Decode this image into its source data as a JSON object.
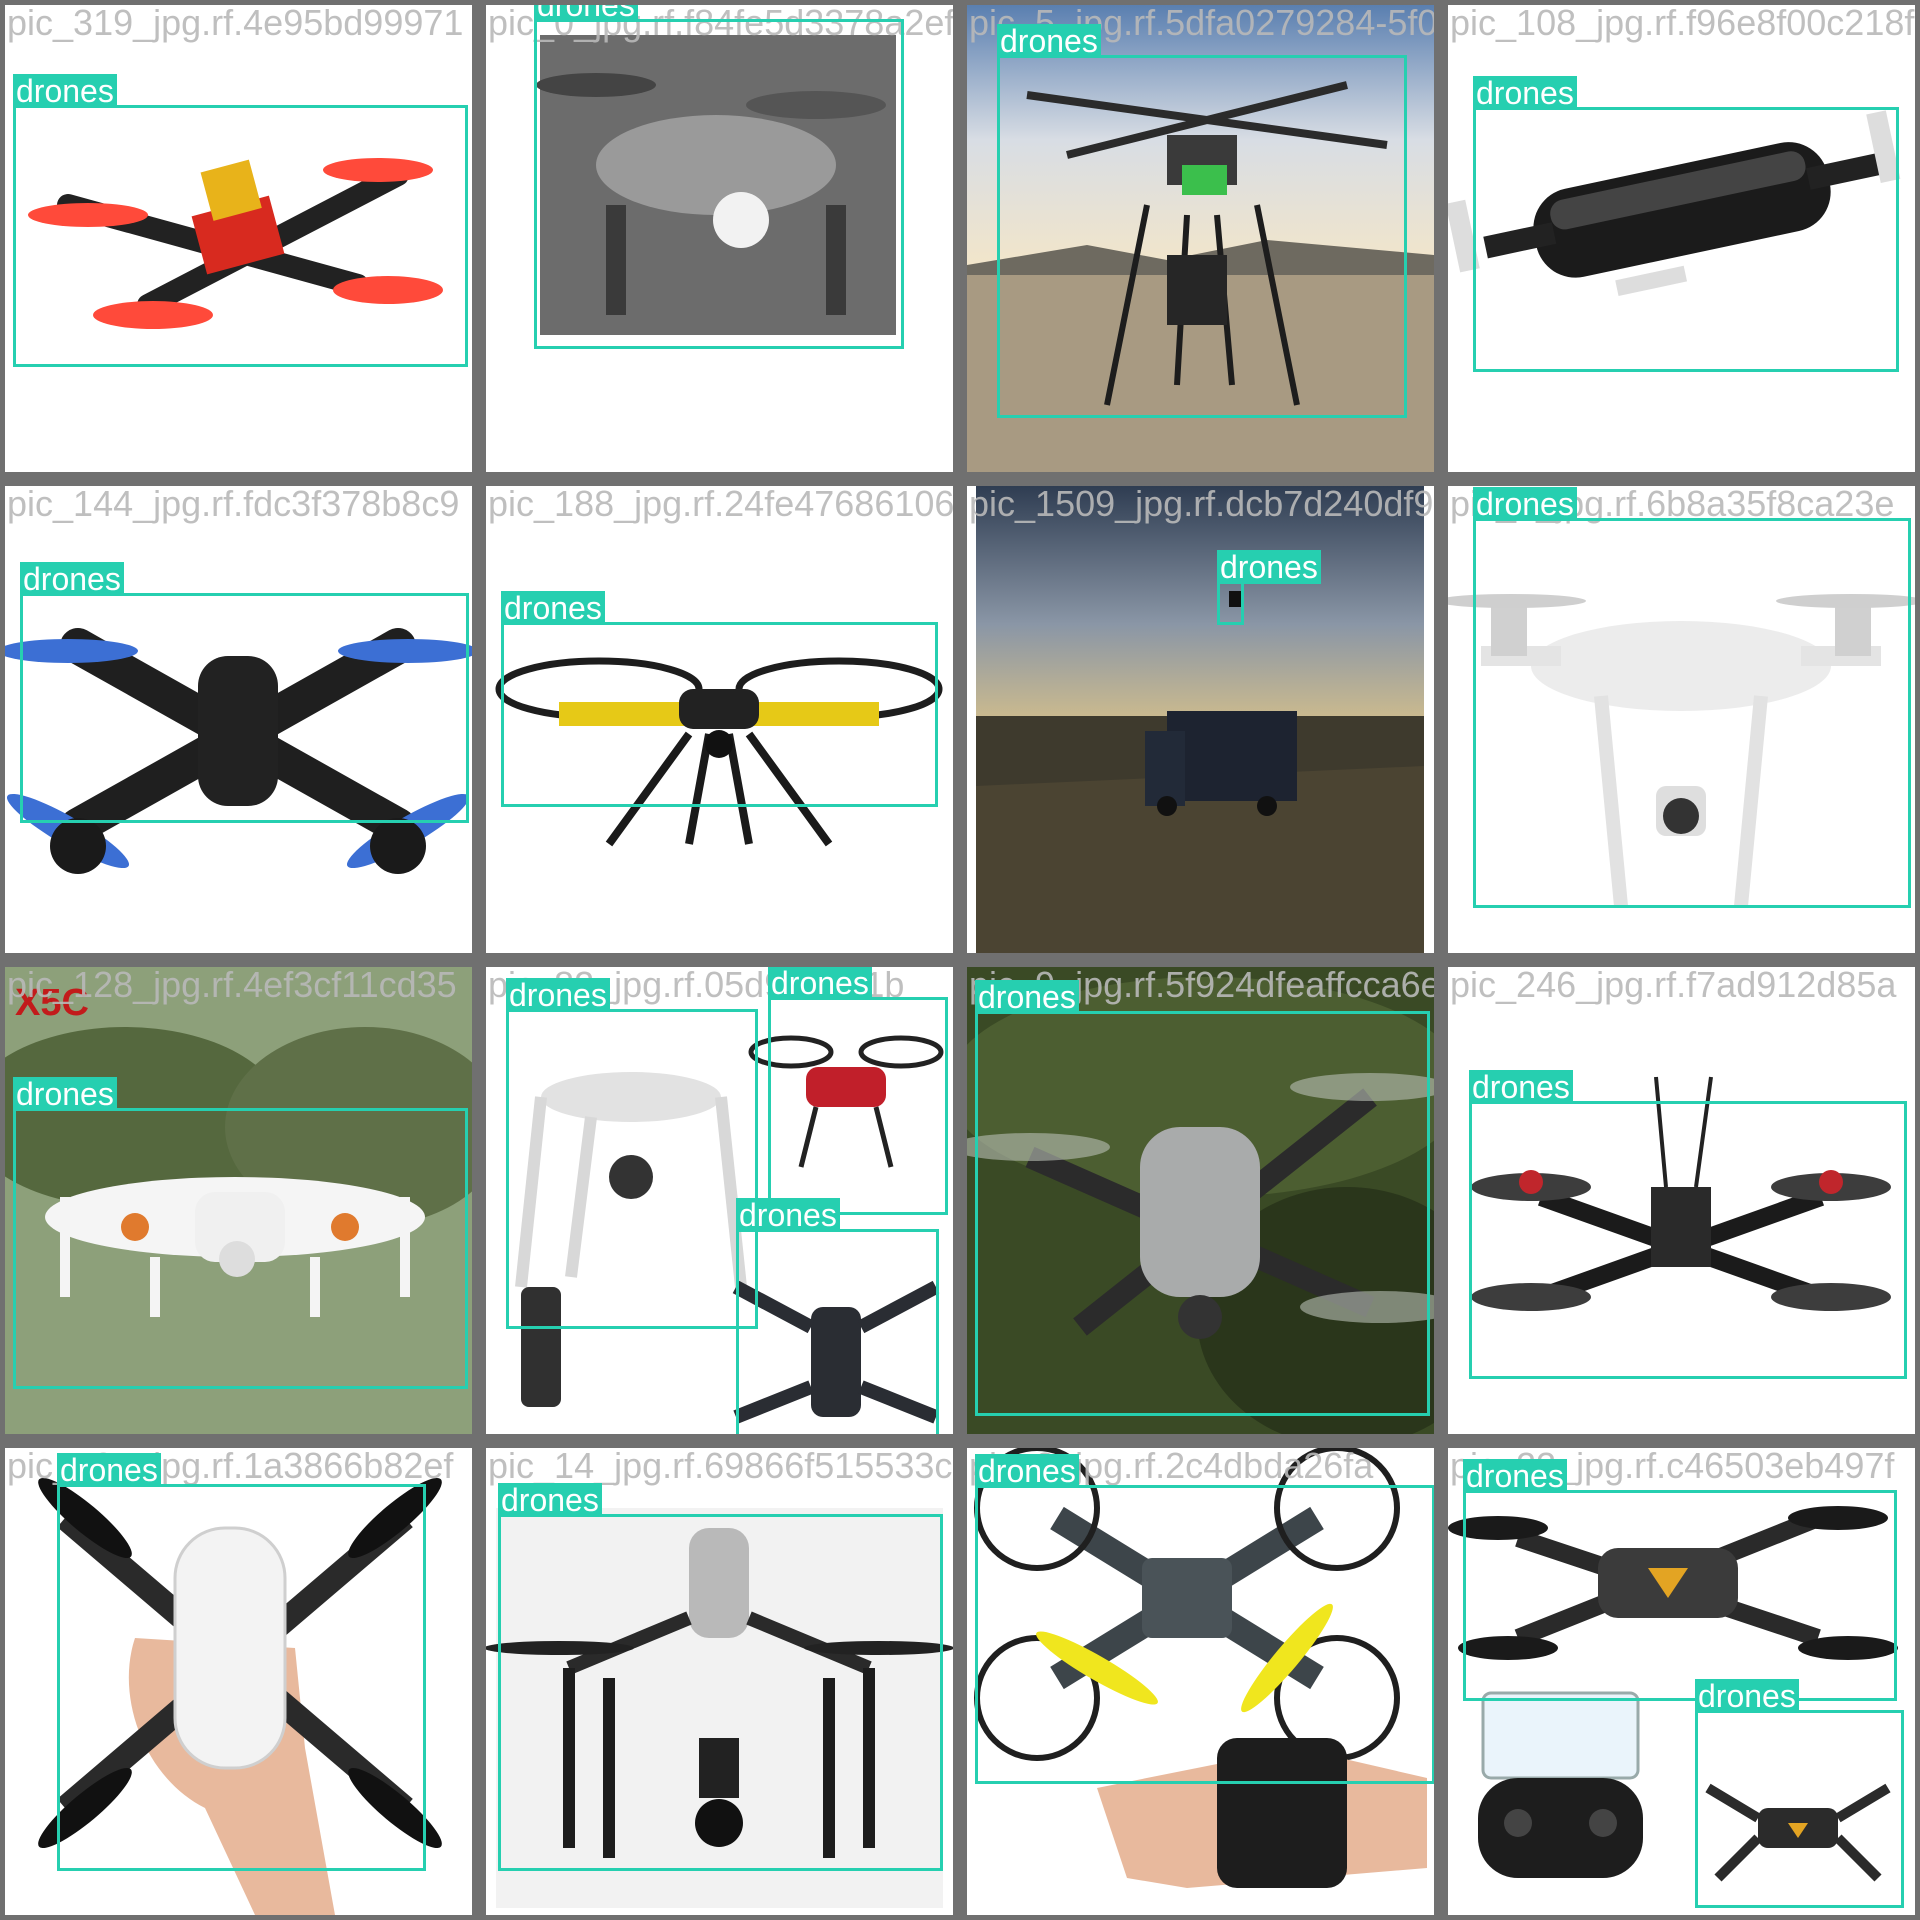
{
  "mosaic": {
    "label_color": "#26cfb0",
    "tiles": [
      {
        "file": "pic_319_jpg.rf.4e95bd99971",
        "subject": "red-racing-drone-icon",
        "boxes": [
          {
            "label": "drones"
          }
        ]
      },
      {
        "file": "pic_0_jpg.rf.f84fe5d3378a2efb9b9cc",
        "subject": "gray-camera-drone-icon",
        "boxes": [
          {
            "label": "drones"
          }
        ]
      },
      {
        "file": "pic_5_jpg.rf.5dfa0279284-5f0",
        "subject": "field-hexacopter-photo",
        "boxes": [
          {
            "label": "drones"
          }
        ]
      },
      {
        "file": "pic_108_jpg.rf.f96e8f00c218f99",
        "subject": "black-selfie-drone-icon",
        "boxes": [
          {
            "label": "drones"
          }
        ]
      },
      {
        "file": "pic_144_jpg.rf.fdc3f378b8c9",
        "subject": "blue-prop-drone-icon",
        "boxes": [
          {
            "label": "drones"
          }
        ]
      },
      {
        "file": "pic_188_jpg.rf.24fe4768610683",
        "subject": "yellow-quadcopter-icon",
        "boxes": [
          {
            "label": "drones"
          }
        ]
      },
      {
        "file": "pic_1509_jpg.rf.dcb7d240df9",
        "subject": "truck-dusk-landscape-photo",
        "boxes": [
          {
            "label": "drones"
          }
        ]
      },
      {
        "file": "pic_4_jpg.rf.6b8a35f8ca23e",
        "subject": "white-phantom-drone-icon",
        "boxes": [
          {
            "label": "drones"
          }
        ]
      },
      {
        "file": "pic_128_jpg.rf.4ef3cf11cd35",
        "subject": "white-toy-drone-photo",
        "boxes": [
          {
            "label": "drones"
          }
        ]
      },
      {
        "file": "pic_82_jpg.rf.05d9e7e91b",
        "subject": "multi-drone-collage",
        "boxes": [
          {
            "label": "drones"
          },
          {
            "label": "drones"
          },
          {
            "label": "drones"
          }
        ]
      },
      {
        "file": "pic_9_jpg.rf.5f924dfeaffcca6e5",
        "subject": "mavic-in-flight-photo",
        "boxes": [
          {
            "label": "drones"
          }
        ]
      },
      {
        "file": "pic_246_jpg.rf.f7ad912d85a",
        "subject": "fpv-racing-frame-icon",
        "boxes": [
          {
            "label": "drones"
          }
        ]
      },
      {
        "file": "pic_127_jpg.rf.1a3866b82ef",
        "subject": "spark-in-hand-photo",
        "boxes": [
          {
            "label": "drones"
          }
        ]
      },
      {
        "file": "pic_14_jpg.rf.69866f515533c60",
        "subject": "inspire-drone-icon",
        "boxes": [
          {
            "label": "drones"
          }
        ]
      },
      {
        "file": "pic_3_jpg.rf.2c4dbda26fa",
        "subject": "gesture-drone-icon",
        "boxes": [
          {
            "label": "drones"
          }
        ]
      },
      {
        "file": "pic_23_jpg.rf.c46503eb497f",
        "subject": "folding-drone-with-controller-icon",
        "boxes": [
          {
            "label": "drones"
          },
          {
            "label": "drones"
          }
        ]
      }
    ]
  }
}
